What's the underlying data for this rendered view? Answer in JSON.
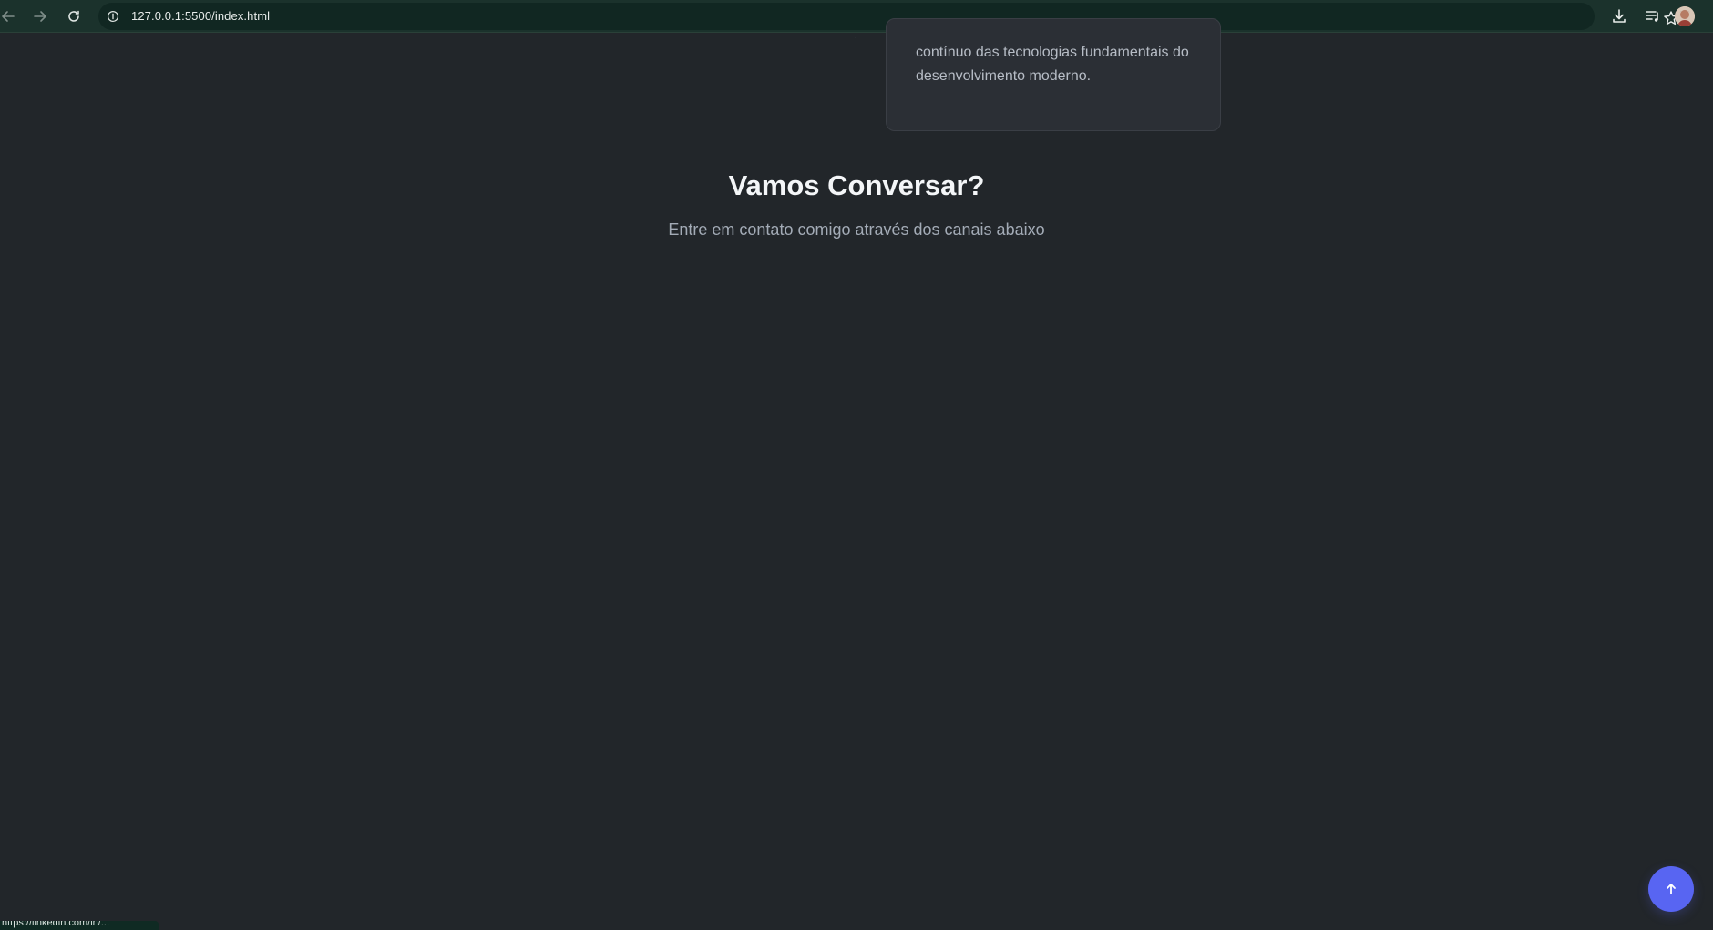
{
  "browser": {
    "url": "127.0.0.1:5500/index.html"
  },
  "card": {
    "text": "contínuo das tecnologias fundamentais do desenvolvimento moderno."
  },
  "contact": {
    "title": "Vamos Conversar?",
    "subtitle": "Entre em contato comigo através dos canais abaixo"
  },
  "status": {
    "link": "https://linkedin.com/in/..."
  },
  "colors": {
    "page_background": "#22262a",
    "browser_bar": "#1b322c",
    "accent": "#5865f2",
    "card_background": "#2b2f35"
  },
  "icons": {
    "back": "arrow-left-icon",
    "forward": "arrow-right-icon",
    "reload": "reload-icon",
    "info": "info-icon",
    "bookmark": "star-icon",
    "download": "download-icon",
    "media": "media-queue-icon",
    "scroll_top": "arrow-up-icon"
  }
}
